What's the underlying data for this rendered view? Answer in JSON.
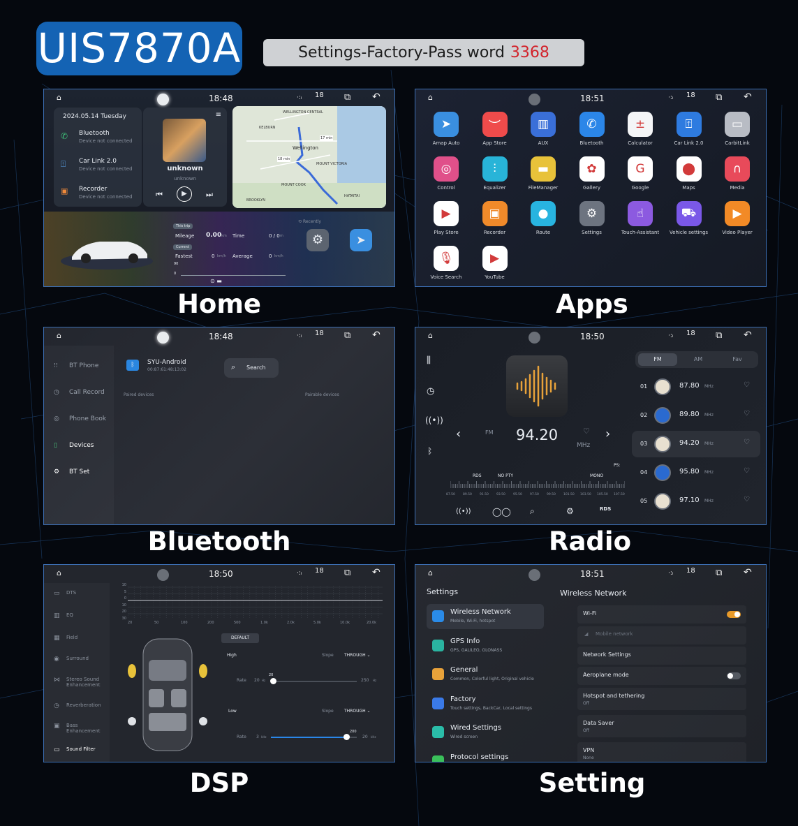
{
  "header": {
    "model": "UIS7870A",
    "pass_label": "Settings-Factory-Pass word",
    "pass_code": "3368"
  },
  "status": {
    "signal": "·:ᵢ",
    "temp": "18",
    "dsp_label": "DSP"
  },
  "captions": {
    "home": "Home",
    "apps": "Apps",
    "bluetooth": "Bluetooth",
    "radio": "Radio",
    "dsp": "DSP",
    "setting": "Setting"
  },
  "home": {
    "time": "18:48",
    "date": "2024.05.14  Tuesday",
    "items": [
      {
        "title": "Bluetooth",
        "sub": "Device not connected"
      },
      {
        "title": "Car Link 2.0",
        "sub": "Device not connected"
      },
      {
        "title": "Recorder",
        "sub": "Device not connected"
      }
    ],
    "music": {
      "title": "unknown",
      "artist": "unknown"
    },
    "map_labels": [
      "WELLINGTON CENTRAL",
      "Wellington",
      "17 min",
      "18 min",
      "MOUNT VICTORIA",
      "BROOKLYN",
      "KELBURN",
      "HATAITAI",
      "MOUNT COOK"
    ],
    "trip": {
      "this_trip": "This trip",
      "current": "Current",
      "mileage_label": "Mileage",
      "mileage": "0.00",
      "mileage_unit": "km",
      "time_label": "Time",
      "time_val": "0 / 0",
      "time_unit": "m",
      "fastest_label": "Fastest",
      "fastest": "0",
      "fastest_unit": "km/h",
      "average_label": "Average",
      "average": "0",
      "average_unit": "km/h",
      "scale_top": "90",
      "scale_mid": "0",
      "scale_bot": "0"
    },
    "recently": "Recently"
  },
  "apps": {
    "time": "18:51",
    "list": [
      {
        "label": "Amap Auto",
        "icon": "navigation-icon",
        "glyph": "➤",
        "color": "#3a8fe0"
      },
      {
        "label": "App Store",
        "icon": "store-icon",
        "glyph": "︶",
        "color": "#ef4b4b"
      },
      {
        "label": "AUX",
        "icon": "aux-icon",
        "glyph": "▥",
        "color": "#3a6fd8"
      },
      {
        "label": "Bluetooth",
        "icon": "phone-icon",
        "glyph": "✆",
        "color": "#2b86e8"
      },
      {
        "label": "Calculator",
        "icon": "calculator-icon",
        "glyph": "±",
        "color": "#f4f5f7"
      },
      {
        "label": "Car Link 2.0",
        "icon": "carlink-icon",
        "glyph": "⍐",
        "color": "#2e7be0"
      },
      {
        "label": "CarbitLink",
        "icon": "carbitlink-icon",
        "glyph": "▭",
        "color": "#b8bcc4"
      },
      {
        "label": "Control",
        "icon": "steering-icon",
        "glyph": "◎",
        "color": "#e0508a"
      },
      {
        "label": "Equalizer",
        "icon": "equalizer-icon",
        "glyph": "⫶",
        "color": "#28b4d8"
      },
      {
        "label": "FileManager",
        "icon": "folder-icon",
        "glyph": "▬",
        "color": "#e8c23a"
      },
      {
        "label": "Gallery",
        "icon": "gallery-icon",
        "glyph": "✿",
        "color": "#ffffff"
      },
      {
        "label": "Google",
        "icon": "google-icon",
        "glyph": "G",
        "color": "#ffffff"
      },
      {
        "label": "Maps",
        "icon": "maps-icon",
        "glyph": "⬤",
        "color": "#ffffff"
      },
      {
        "label": "Media",
        "icon": "headphones-icon",
        "glyph": "∩",
        "color": "#e84a5a"
      },
      {
        "label": "Play Store",
        "icon": "play-store-icon",
        "glyph": "▶",
        "color": "#ffffff"
      },
      {
        "label": "Recorder",
        "icon": "recorder-icon",
        "glyph": "▣",
        "color": "#f08a2a"
      },
      {
        "label": "Route",
        "icon": "route-icon",
        "glyph": "●",
        "color": "#28b4e0"
      },
      {
        "label": "Settings",
        "icon": "settings-icon",
        "glyph": "⚙",
        "color": "#6d7480"
      },
      {
        "label": "Touch-Assistant",
        "icon": "touch-icon",
        "glyph": "☝",
        "color": "#8c5ae0"
      },
      {
        "label": "Vehicle settings",
        "icon": "vehicle-icon",
        "glyph": "⛟",
        "color": "#7a58e8"
      },
      {
        "label": "Video Player",
        "icon": "video-icon",
        "glyph": "▶",
        "color": "#f28a26"
      },
      {
        "label": "Voice Search",
        "icon": "microphone-icon",
        "glyph": "🎙",
        "color": "#ffffff"
      },
      {
        "label": "YouTube",
        "icon": "youtube-icon",
        "glyph": "▶",
        "color": "#ffffff"
      }
    ]
  },
  "bluetooth": {
    "time": "18:48",
    "menu": [
      "BT Phone",
      "Call Record",
      "Phone Book",
      "Devices",
      "BT Set"
    ],
    "device_name": "SYU-Android",
    "device_mac": "00:87:61:48:13:02",
    "search": "Search",
    "paired": "Paired devices",
    "pairable": "Pairable devices"
  },
  "radio": {
    "time": "18:50",
    "band": "FM",
    "freq": "94.20",
    "unit": "MHz",
    "tabs": [
      "FM",
      "AM",
      "Fav"
    ],
    "rds": "RDS",
    "pty": "NO PTY",
    "mono": "MONO",
    "ps": "PS:",
    "scale": [
      "87.50",
      "89.50",
      "91.50",
      "93.50",
      "95.50",
      "97.50",
      "99.50",
      "101.50",
      "103.50",
      "105.50",
      "107.50"
    ],
    "stations": [
      {
        "num": "01",
        "freq": "87.80",
        "unit": "MHz"
      },
      {
        "num": "02",
        "freq": "89.80",
        "unit": "MHz"
      },
      {
        "num": "03",
        "freq": "94.20",
        "unit": "MHz"
      },
      {
        "num": "04",
        "freq": "95.80",
        "unit": "MHz"
      },
      {
        "num": "05",
        "freq": "97.10",
        "unit": "MHz"
      }
    ],
    "rds_logo": "RDS"
  },
  "dsp": {
    "time": "18:50",
    "menu": [
      "DTS",
      "EQ",
      "Field",
      "Surround",
      "Stereo Sound Enhancement",
      "Reverberation",
      "Bass Enhancement",
      "Sound Filter"
    ],
    "y_ticks": [
      "10",
      "5",
      "0",
      "10",
      "20",
      "30"
    ],
    "x_ticks": [
      "20",
      "50",
      "100",
      "200",
      "500",
      "1.0k",
      "2.0k",
      "5.0k",
      "10.0k",
      "20.0k"
    ],
    "preset": "DEFAULT",
    "high": "High",
    "low": "Low",
    "slope": "Slope",
    "through": "THROUGH",
    "rate": "Rate",
    "high_min": "20",
    "high_val": "20",
    "high_max": "250",
    "low_min": "3",
    "low_val": "200",
    "low_max": "20",
    "unit_hz": "Hz",
    "unit_khz": "kHz",
    "high_level": 0.0,
    "low_level": 0.88
  },
  "settings": {
    "time": "18:51",
    "title": "Settings",
    "right_title": "Wireless Network",
    "items": [
      {
        "title": "Wireless Network",
        "sub": "Mobile, Wi-Fi, hotspot",
        "color": "#2a8be8"
      },
      {
        "title": "GPS Info",
        "sub": "GPS, GALILEO, GLONASS",
        "color": "#2ab4a0"
      },
      {
        "title": "General",
        "sub": "Common, Colorful light, Original vehicle",
        "color": "#e8a23a"
      },
      {
        "title": "Factory",
        "sub": "Touch settings, BackCar, Local settings",
        "color": "#3a7ae8"
      },
      {
        "title": "Wired Settings",
        "sub": "Wired screen",
        "color": "#2abca8"
      },
      {
        "title": "Protocol settings",
        "sub": "",
        "color": "#3ac05a"
      }
    ],
    "rows": [
      {
        "title": "Wi-Fi",
        "sub": ""
      },
      {
        "title": "Mobile network",
        "sub": ""
      },
      {
        "title": "Network Settings",
        "sub": ""
      },
      {
        "title": "Aeroplane mode",
        "sub": ""
      },
      {
        "title": "Hotspot and tethering",
        "sub": "Off"
      },
      {
        "title": "Data Saver",
        "sub": "Off"
      },
      {
        "title": "VPN",
        "sub": "None"
      }
    ],
    "wifi_on": true,
    "aeroplane_on": false
  }
}
